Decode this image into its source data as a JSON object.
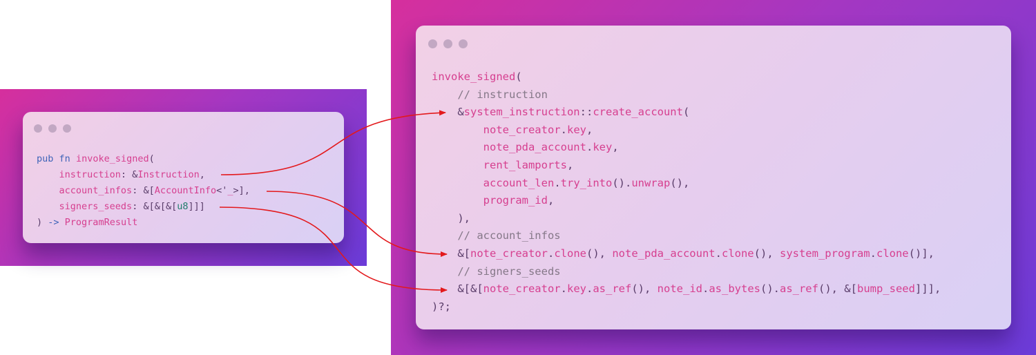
{
  "left_card": {
    "lines": [
      [
        {
          "t": "pub",
          "c": "kw"
        },
        {
          "t": " ",
          "c": "pu"
        },
        {
          "t": "fn",
          "c": "kw"
        },
        {
          "t": " ",
          "c": "pu"
        },
        {
          "t": "invoke_signed",
          "c": "fn"
        },
        {
          "t": "(",
          "c": "pu"
        }
      ],
      [
        {
          "t": "    ",
          "c": "pu"
        },
        {
          "t": "instruction",
          "c": "id"
        },
        {
          "t": ": &",
          "c": "pu"
        },
        {
          "t": "Instruction",
          "c": "ty"
        },
        {
          "t": ",",
          "c": "pu"
        }
      ],
      [
        {
          "t": "    ",
          "c": "pu"
        },
        {
          "t": "account_infos",
          "c": "id"
        },
        {
          "t": ": &[",
          "c": "pu"
        },
        {
          "t": "AccountInfo",
          "c": "ty"
        },
        {
          "t": "<'",
          "c": "pu"
        },
        {
          "t": "_",
          "c": "id"
        },
        {
          "t": ">],",
          "c": "pu"
        }
      ],
      [
        {
          "t": "    ",
          "c": "pu"
        },
        {
          "t": "signers_seeds",
          "c": "id"
        },
        {
          "t": ": &[&[&[",
          "c": "pu"
        },
        {
          "t": "u8",
          "c": "prim"
        },
        {
          "t": "]]]",
          "c": "pu"
        }
      ],
      [
        {
          "t": ") ",
          "c": "pu"
        },
        {
          "t": "->",
          "c": "ar"
        },
        {
          "t": " ",
          "c": "pu"
        },
        {
          "t": "ProgramResult",
          "c": "ty"
        }
      ]
    ]
  },
  "right_card": {
    "lines": [
      [
        {
          "t": "invoke_signed",
          "c": "fn"
        },
        {
          "t": "(",
          "c": "pu"
        }
      ],
      [
        {
          "t": "    ",
          "c": "pu"
        },
        {
          "t": "// instruction",
          "c": "cm"
        }
      ],
      [
        {
          "t": "    &",
          "c": "pu"
        },
        {
          "t": "system_instruction",
          "c": "id"
        },
        {
          "t": "::",
          "c": "pu"
        },
        {
          "t": "create_account",
          "c": "fn"
        },
        {
          "t": "(",
          "c": "pu"
        }
      ],
      [
        {
          "t": "        ",
          "c": "pu"
        },
        {
          "t": "note_creator",
          "c": "id"
        },
        {
          "t": ".",
          "c": "pu"
        },
        {
          "t": "key",
          "c": "id"
        },
        {
          "t": ",",
          "c": "pu"
        }
      ],
      [
        {
          "t": "        ",
          "c": "pu"
        },
        {
          "t": "note_pda_account",
          "c": "id"
        },
        {
          "t": ".",
          "c": "pu"
        },
        {
          "t": "key",
          "c": "id"
        },
        {
          "t": ",",
          "c": "pu"
        }
      ],
      [
        {
          "t": "        ",
          "c": "pu"
        },
        {
          "t": "rent_lamports",
          "c": "id"
        },
        {
          "t": ",",
          "c": "pu"
        }
      ],
      [
        {
          "t": "        ",
          "c": "pu"
        },
        {
          "t": "account_len",
          "c": "id"
        },
        {
          "t": ".",
          "c": "pu"
        },
        {
          "t": "try_into",
          "c": "fn"
        },
        {
          "t": "().",
          "c": "pu"
        },
        {
          "t": "unwrap",
          "c": "fn"
        },
        {
          "t": "(),",
          "c": "pu"
        }
      ],
      [
        {
          "t": "        ",
          "c": "pu"
        },
        {
          "t": "program_id",
          "c": "id"
        },
        {
          "t": ",",
          "c": "pu"
        }
      ],
      [
        {
          "t": "    ),",
          "c": "pu"
        }
      ],
      [
        {
          "t": "    ",
          "c": "pu"
        },
        {
          "t": "// account_infos",
          "c": "cm"
        }
      ],
      [
        {
          "t": "    &[",
          "c": "pu"
        },
        {
          "t": "note_creator",
          "c": "id"
        },
        {
          "t": ".",
          "c": "pu"
        },
        {
          "t": "clone",
          "c": "fn"
        },
        {
          "t": "(), ",
          "c": "pu"
        },
        {
          "t": "note_pda_account",
          "c": "id"
        },
        {
          "t": ".",
          "c": "pu"
        },
        {
          "t": "clone",
          "c": "fn"
        },
        {
          "t": "(), ",
          "c": "pu"
        },
        {
          "t": "system_program",
          "c": "id"
        },
        {
          "t": ".",
          "c": "pu"
        },
        {
          "t": "clone",
          "c": "fn"
        },
        {
          "t": "()],",
          "c": "pu"
        }
      ],
      [
        {
          "t": "    ",
          "c": "pu"
        },
        {
          "t": "// signers_seeds",
          "c": "cm"
        }
      ],
      [
        {
          "t": "    &[&[",
          "c": "pu"
        },
        {
          "t": "note_creator",
          "c": "id"
        },
        {
          "t": ".",
          "c": "pu"
        },
        {
          "t": "key",
          "c": "id"
        },
        {
          "t": ".",
          "c": "pu"
        },
        {
          "t": "as_ref",
          "c": "fn"
        },
        {
          "t": "(), ",
          "c": "pu"
        },
        {
          "t": "note_id",
          "c": "id"
        },
        {
          "t": ".",
          "c": "pu"
        },
        {
          "t": "as_bytes",
          "c": "fn"
        },
        {
          "t": "().",
          "c": "pu"
        },
        {
          "t": "as_ref",
          "c": "fn"
        },
        {
          "t": "(), &[",
          "c": "pu"
        },
        {
          "t": "bump_seed",
          "c": "id"
        },
        {
          "t": "]]],",
          "c": "pu"
        }
      ],
      [
        {
          "t": ")?;",
          "c": "pu"
        }
      ]
    ]
  },
  "colors": {
    "arrow": "#e3191c"
  }
}
